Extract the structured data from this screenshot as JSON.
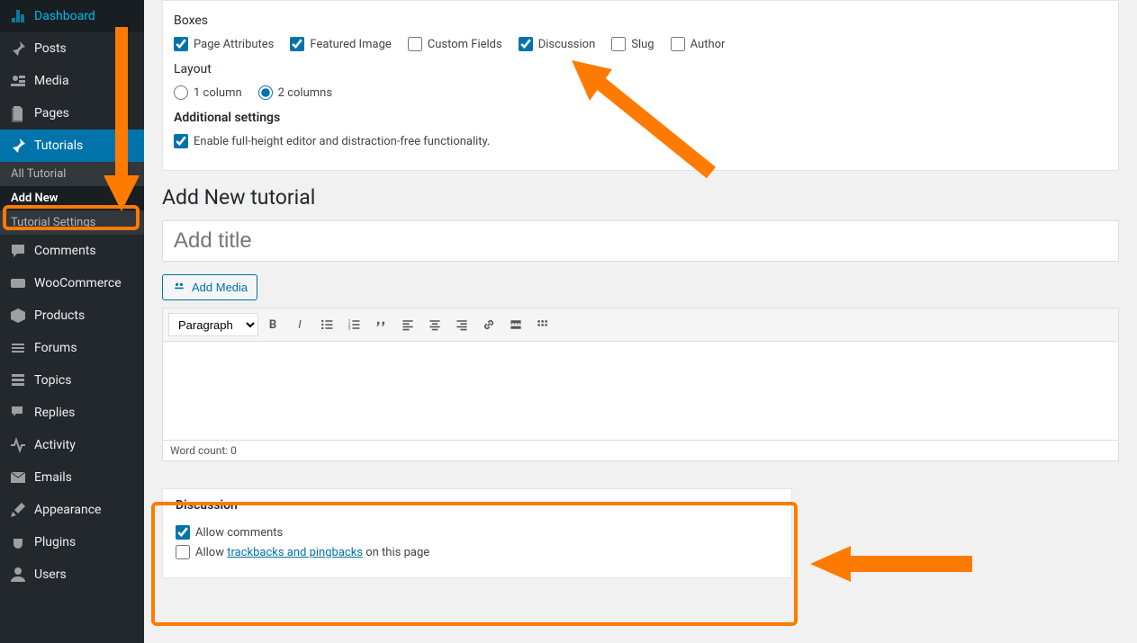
{
  "sidebar": {
    "items": [
      {
        "label": "Dashboard",
        "icon": "dashboard"
      },
      {
        "label": "Posts",
        "icon": "pin"
      },
      {
        "label": "Media",
        "icon": "media"
      },
      {
        "label": "Pages",
        "icon": "pages"
      },
      {
        "label": "Tutorials",
        "icon": "pin"
      },
      {
        "label": "Comments",
        "icon": "comment"
      },
      {
        "label": "WooCommerce",
        "icon": "woo"
      },
      {
        "label": "Products",
        "icon": "cube"
      },
      {
        "label": "Forums",
        "icon": "forum"
      },
      {
        "label": "Topics",
        "icon": "topics"
      },
      {
        "label": "Replies",
        "icon": "replies"
      },
      {
        "label": "Activity",
        "icon": "activity"
      },
      {
        "label": "Emails",
        "icon": "email"
      },
      {
        "label": "Appearance",
        "icon": "brush"
      },
      {
        "label": "Plugins",
        "icon": "plugin"
      },
      {
        "label": "Users",
        "icon": "users"
      }
    ],
    "submenu": {
      "items": [
        {
          "label": "All Tutorial"
        },
        {
          "label": "Add New"
        },
        {
          "label": "Tutorial Settings"
        }
      ]
    }
  },
  "screen_options": {
    "boxes_label": "Boxes",
    "checkboxes": [
      {
        "label": "Page Attributes",
        "checked": true
      },
      {
        "label": "Featured Image",
        "checked": true
      },
      {
        "label": "Custom Fields",
        "checked": false
      },
      {
        "label": "Discussion",
        "checked": true
      },
      {
        "label": "Slug",
        "checked": false
      },
      {
        "label": "Author",
        "checked": false
      }
    ],
    "layout_label": "Layout",
    "layout_options": [
      {
        "label": "1 column",
        "checked": false
      },
      {
        "label": "2 columns",
        "checked": true
      }
    ],
    "additional_label": "Additional settings",
    "fullheight_label": "Enable full-height editor and distraction-free functionality.",
    "fullheight_checked": true
  },
  "page": {
    "heading": "Add New tutorial",
    "title_placeholder": "Add title",
    "add_media": "Add Media",
    "format_select": "Paragraph",
    "word_count_label": "Word count: 0"
  },
  "discussion": {
    "heading": "Discussion",
    "allow_comments": "Allow comments",
    "allow_comments_checked": true,
    "trackbacks_prefix": "Allow ",
    "trackbacks_link": "trackbacks and pingbacks",
    "trackbacks_suffix": " on this page",
    "trackbacks_checked": false
  }
}
